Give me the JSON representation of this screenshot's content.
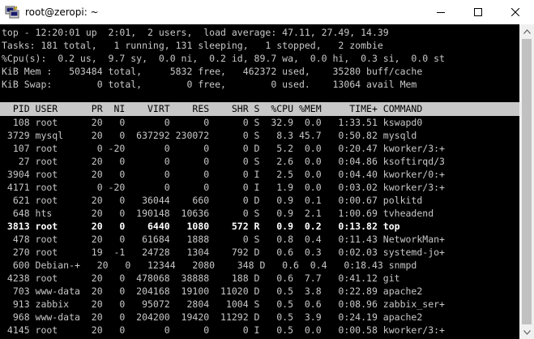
{
  "window": {
    "title": "root@zeropi: ~",
    "icon": "putty-terminal-icon",
    "controls": [
      "minimize-icon",
      "maximize-icon",
      "close-icon"
    ]
  },
  "summary": [
    "top - 12:20:01 up  2:01,  2 users,  load average: 47.11, 27.49, 14.39",
    "Tasks: 181 total,   1 running, 131 sleeping,   1 stopped,   2 zombie",
    "%Cpu(s):  0.2 us,  9.7 sy,  0.0 ni,  0.2 id, 89.7 wa,  0.0 hi,  0.3 si,  0.0 st",
    "KiB Mem :   503484 total,     5832 free,   462372 used,    35280 buff/cache",
    "KiB Swap:        0 total,        0 free,        0 used.    13064 avail Mem"
  ],
  "process_header": "  PID USER      PR  NI    VIRT    RES    SHR S  %CPU %MEM     TIME+ COMMAND",
  "processes": [
    {
      "text": "  108 root      20   0       0      0      0 S  32.9  0.0   1:33.51 kswapd0",
      "bold": false
    },
    {
      "text": " 3729 mysql     20   0  637292 230072      0 S   8.3 45.7   0:50.82 mysqld",
      "bold": false
    },
    {
      "text": "  107 root       0 -20       0      0      0 D   5.2  0.0   0:20.47 kworker/3:+",
      "bold": false
    },
    {
      "text": "   27 root      20   0       0      0      0 S   2.6  0.0   0:04.86 ksoftirqd/3",
      "bold": false
    },
    {
      "text": " 3904 root      20   0       0      0      0 I   2.5  0.0   0:04.40 kworker/0:+",
      "bold": false
    },
    {
      "text": " 4171 root       0 -20       0      0      0 I   1.9  0.0   0:03.02 kworker/3:+",
      "bold": false
    },
    {
      "text": "  621 root      20   0   36044    660      0 D   0.9  0.1   0:00.67 polkitd",
      "bold": false
    },
    {
      "text": "  648 hts       20   0  190148  10636      0 S   0.9  2.1   1:00.69 tvheadend",
      "bold": false
    },
    {
      "text": " 3813 root      20   0    6440   1080    572 R   0.9  0.2   0:13.82 top",
      "bold": true
    },
    {
      "text": "  478 root      20   0   61684   1888      0 S   0.8  0.4   0:11.43 NetworkMan+",
      "bold": false
    },
    {
      "text": "  270 root      19  -1   24728   1304    792 D   0.6  0.3   0:02.03 systemd-jo+",
      "bold": false
    },
    {
      "text": "  600 Debian-+   20   0   12344   2080    348 D   0.6  0.4   0:18.43 snmpd",
      "bold": false
    },
    {
      "text": " 4238 root      20   0  478068  38888    188 D   0.6  7.7   0:41.12 git",
      "bold": false
    },
    {
      "text": "  703 www-data  20   0  204168  19100  11020 D   0.5  3.8   0:22.89 apache2",
      "bold": false
    },
    {
      "text": "  913 zabbix    20   0   95072   2804   1004 S   0.5  0.6   0:08.96 zabbix_ser+",
      "bold": false
    },
    {
      "text": "  968 www-data  20   0  204200  19420  11292 D   0.5  3.9   0:24.19 apache2",
      "bold": false
    },
    {
      "text": " 4145 root      20   0       0      0      0 I   0.5  0.0   0:00.58 kworker/3:+",
      "bold": false
    }
  ]
}
